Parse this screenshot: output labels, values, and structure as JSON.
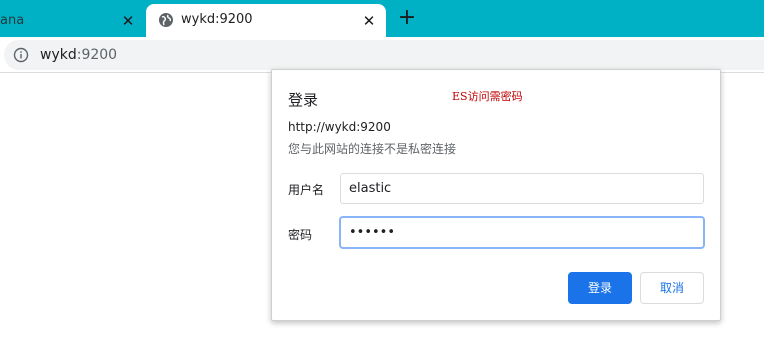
{
  "tabs": [
    {
      "title": "ana",
      "close_icon": "close-icon"
    },
    {
      "title": "wykd:9200",
      "icon": "globe-icon",
      "close_icon": "close-icon"
    }
  ],
  "new_tab_icon": "plus-icon",
  "omnibox": {
    "icon": "info-icon",
    "host": "wykd",
    "port": ":9200"
  },
  "dialog": {
    "title": "登录",
    "annotation": "ES访问需密码",
    "site_url": "http://wykd:9200",
    "privacy_note": "您与此网站的连接不是私密连接",
    "username_label": "用户名",
    "username_value": "elastic",
    "password_label": "密码",
    "password_value": "••••••",
    "login_button": "登录",
    "cancel_button": "取消"
  },
  "colors": {
    "tabstrip": "#00b0c4",
    "primary": "#1a73e8",
    "annotation": "#c00000"
  }
}
